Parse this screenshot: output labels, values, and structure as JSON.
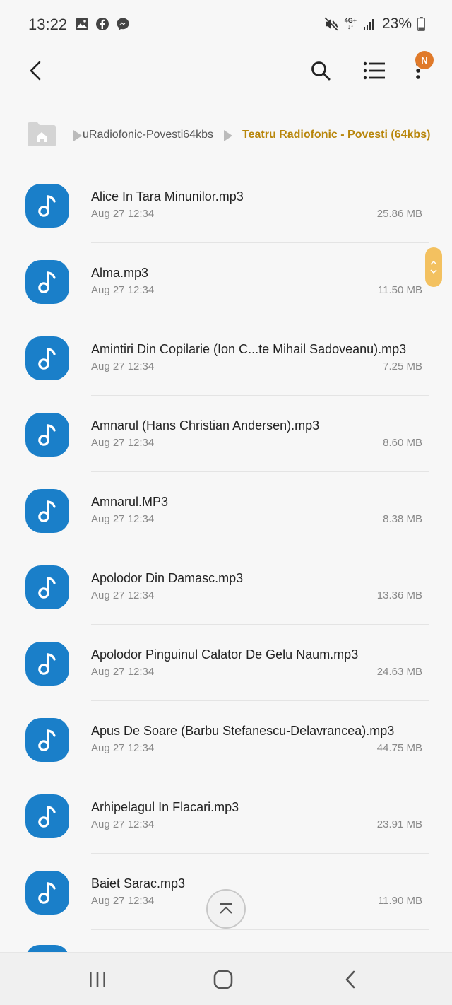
{
  "status_bar": {
    "time": "13:22",
    "left_icons": [
      "gallery-icon",
      "facebook-icon",
      "messenger-icon"
    ],
    "network": "4G+",
    "battery_percent": "23%"
  },
  "toolbar": {
    "badge_letter": "N",
    "badge_color": "#e07a2a"
  },
  "breadcrumb": {
    "items": [
      "uRadiofonic-Povesti64kbs",
      "Teatru Radiofonic - Povesti (64kbs)"
    ],
    "active_color": "#b8860b"
  },
  "files": [
    {
      "name": "Alice In Tara Minunilor.mp3",
      "date": "Aug 27 12:34",
      "size": "25.86 MB"
    },
    {
      "name": "Alma.mp3",
      "date": "Aug 27 12:34",
      "size": "11.50 MB"
    },
    {
      "name": "Amintiri Din Copilarie (Ion C...te Mihail Sadoveanu).mp3",
      "date": "Aug 27 12:34",
      "size": "7.25 MB"
    },
    {
      "name": "Amnarul (Hans Christian Andersen).mp3",
      "date": "Aug 27 12:34",
      "size": "8.60 MB"
    },
    {
      "name": "Amnarul.MP3",
      "date": "Aug 27 12:34",
      "size": "8.38 MB"
    },
    {
      "name": "Apolodor Din Damasc.mp3",
      "date": "Aug 27 12:34",
      "size": "13.36 MB"
    },
    {
      "name": "Apolodor Pinguinul Calator De Gelu Naum.mp3",
      "date": "Aug 27 12:34",
      "size": "24.63 MB"
    },
    {
      "name": "Apus De Soare (Barbu Stefanescu-Delavrancea).mp3",
      "date": "Aug 27 12:34",
      "size": "44.75 MB"
    },
    {
      "name": "Arhipelagul In Flacari.mp3",
      "date": "Aug 27 12:34",
      "size": "23.91 MB"
    },
    {
      "name": "Baiet Sarac.mp3",
      "date": "Aug 27 12:34",
      "size": "11.90 MB"
    }
  ],
  "colors": {
    "file_icon": "#1a7fc9",
    "scroll_handle": "#f3c160"
  }
}
